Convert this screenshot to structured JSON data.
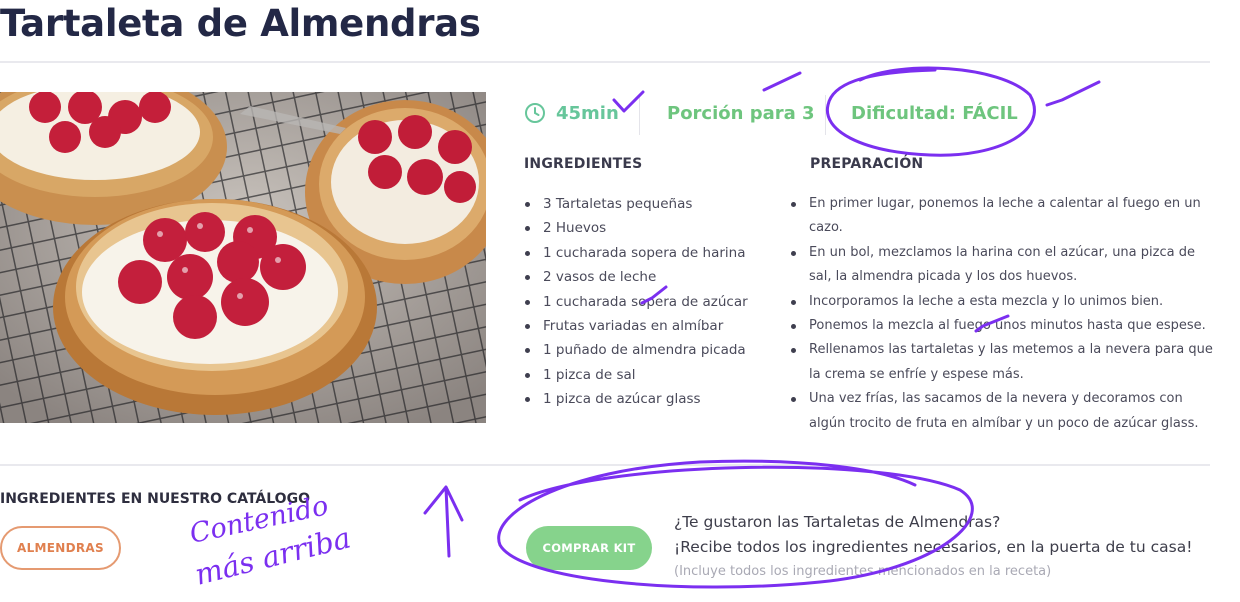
{
  "recipe": {
    "title": "Tartaleta de Almendras",
    "photo_alt": "tartaletas con frambuesas",
    "meta": {
      "time": "45min",
      "portions": "Porción para 3",
      "difficulty": "Dificultad: FÁCIL"
    },
    "ingredients_title": "INGREDIENTES",
    "ingredients": [
      "3 Tartaletas pequeñas",
      "2 Huevos",
      "1 cucharada sopera de harina",
      "2 vasos de leche",
      "1 cucharada sopera de azúcar",
      "Frutas variadas en almíbar",
      "1 puñado de almendra picada",
      "1 pizca de sal",
      "1 pizca de azúcar glass"
    ],
    "preparation_title": "PREPARACIÓN",
    "preparation": [
      "En primer lugar, ponemos la leche a calentar al fuego en un cazo.",
      "En un bol, mezclamos la harina con el azúcar, una pizca de sal, la almendra picada y los dos huevos.",
      "Incorporamos la leche a esta mezcla y lo unimos bien.",
      "Ponemos la mezcla al fuego unos minutos hasta que espese.",
      "Rellenamos las tartaletas y las metemos a la nevera para que la crema se enfríe y espese más.",
      "Una vez frías, las sacamos de la nevera y decoramos con algún trocito de fruta en almíbar y un poco de azúcar glass."
    ]
  },
  "catalog": {
    "title": "INGREDIENTES EN NUESTRO CATÁLOGO",
    "tag": "ALMENDRAS"
  },
  "kit": {
    "button": "COMPRAR KIT",
    "line1": "¿Te gustaron las  Tartaletas de Almendras?",
    "line2": "¡Recibe todos los ingredientes necesarios, en la puerta de tu casa!",
    "note": "(Incluye todos los ingredientes mencionados en la receta)"
  },
  "annotation": {
    "handwritten_line1": "Contenido",
    "handwritten_line2": "más arriba",
    "ink_color": "#7b2ff0"
  },
  "colors": {
    "title": "#232846",
    "accent_green": "#6ec57e",
    "orange": "#e0804f",
    "kit_button": "#86d38c"
  }
}
